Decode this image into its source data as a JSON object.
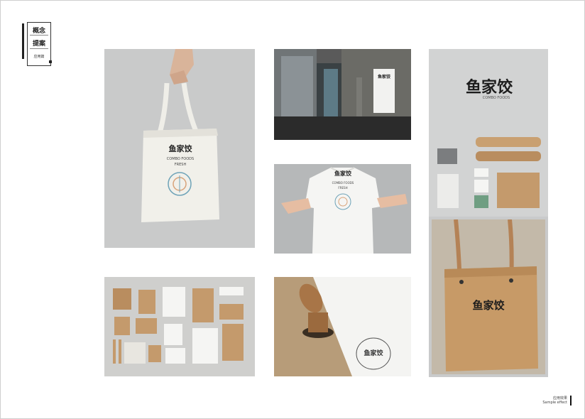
{
  "header": {
    "line1": "概念",
    "line2": "提案",
    "line3": "应用篇"
  },
  "brand": {
    "logo_text": "鱼家饺",
    "sub_text": "COMBO FOODS"
  },
  "tote": {
    "title": "COMBO FOODS",
    "subtitle": "FRESH"
  },
  "tshirt": {
    "title": "COMBO FOODS",
    "subtitle": "FRESH"
  },
  "footer": {
    "caption_line1": "应用效果",
    "caption_line2": "Sample effect"
  },
  "colors": {
    "gray_bg": "#c7c8c8",
    "kraft": "#c49a6c",
    "dark_floor": "#3a3a3a"
  }
}
